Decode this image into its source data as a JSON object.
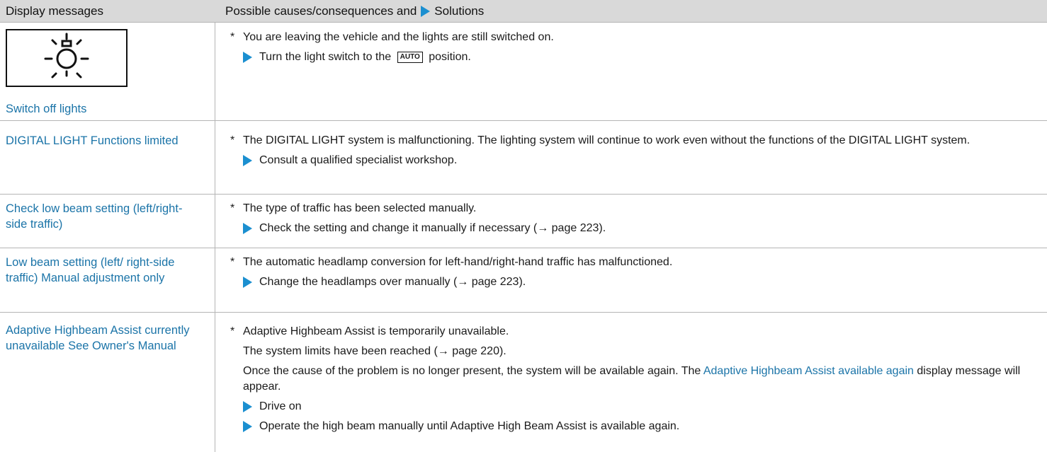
{
  "header": {
    "col1": "Display messages",
    "col2_before": "Possible causes/consequences and",
    "col2_after": "Solutions"
  },
  "rows": [
    {
      "icon": "lights-on-warning-icon",
      "message": "Switch off lights",
      "cause": "You are leaving the vehicle and the lights are still switched on.",
      "solution_before": "Turn the light switch to the",
      "key_label": "AUTO",
      "solution_after": "position."
    },
    {
      "message": "DIGITAL LIGHT Functions limited",
      "cause": "The DIGITAL LIGHT system is malfunctioning. The lighting system will continue to work even without the functions of the DIGITAL LIGHT system.",
      "solution": "Consult a qualified specialist workshop."
    },
    {
      "message": "Check low beam setting (left/right-side traffic)",
      "cause": "The type of traffic has been selected manually.",
      "solution": "Check the setting and change it manually if necessary (→ page 223)."
    },
    {
      "message": "Low beam setting (left/ right-side traffic) Manual adjustment only",
      "cause": "The automatic headlamp conversion for left-hand/right-hand traffic has malfunctioned.",
      "solution": "Change the headlamps over manually (→ page 223)."
    },
    {
      "message": "Adaptive Highbeam Assist currently unavailable See Owner's Manual",
      "cause": "Adaptive Highbeam Assist is temporarily unavailable.",
      "note1": "The system limits have been reached (→ page 220).",
      "note2_before": "Once the cause of the problem is no longer present, the system will be available again. The",
      "note2_link": "Adaptive Highbeam Assist available again",
      "note2_after": "display message will appear.",
      "solution1": "Drive on",
      "solution2": "Operate the high beam manually until Adaptive High Beam Assist is available again."
    }
  ],
  "colors": {
    "link": "#1b74a8",
    "arrow": "#1b8fd0",
    "header_bg": "#d9d9d9",
    "rule": "#b5b5b5"
  }
}
